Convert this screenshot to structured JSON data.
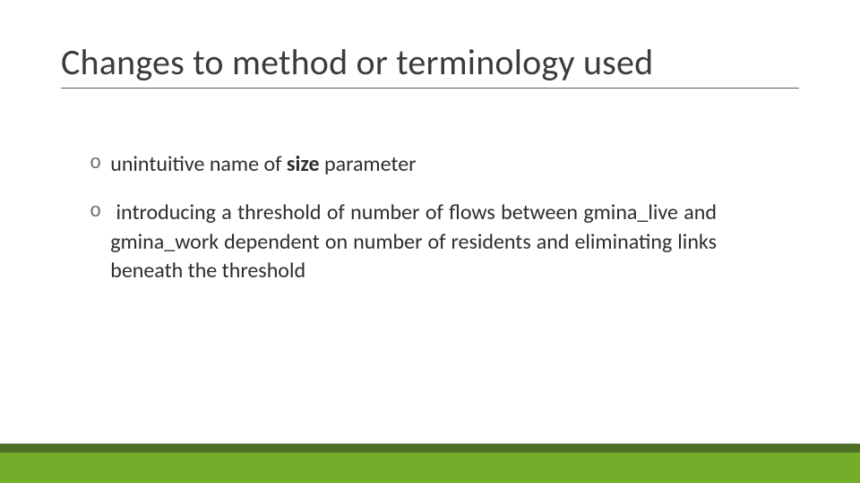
{
  "title": "Changes to method or terminology used",
  "bullets": [
    {
      "marker": "o",
      "html": "unintuitive name of <b>size</b> parameter",
      "justify": false
    },
    {
      "marker": "o",
      "html": "&nbsp;introducing a threshold of number of flows between gmina_live and gmina_work dependent on number of residents and eliminating links beneath the threshold",
      "justify": true
    }
  ],
  "accent_color": "#73ad29"
}
